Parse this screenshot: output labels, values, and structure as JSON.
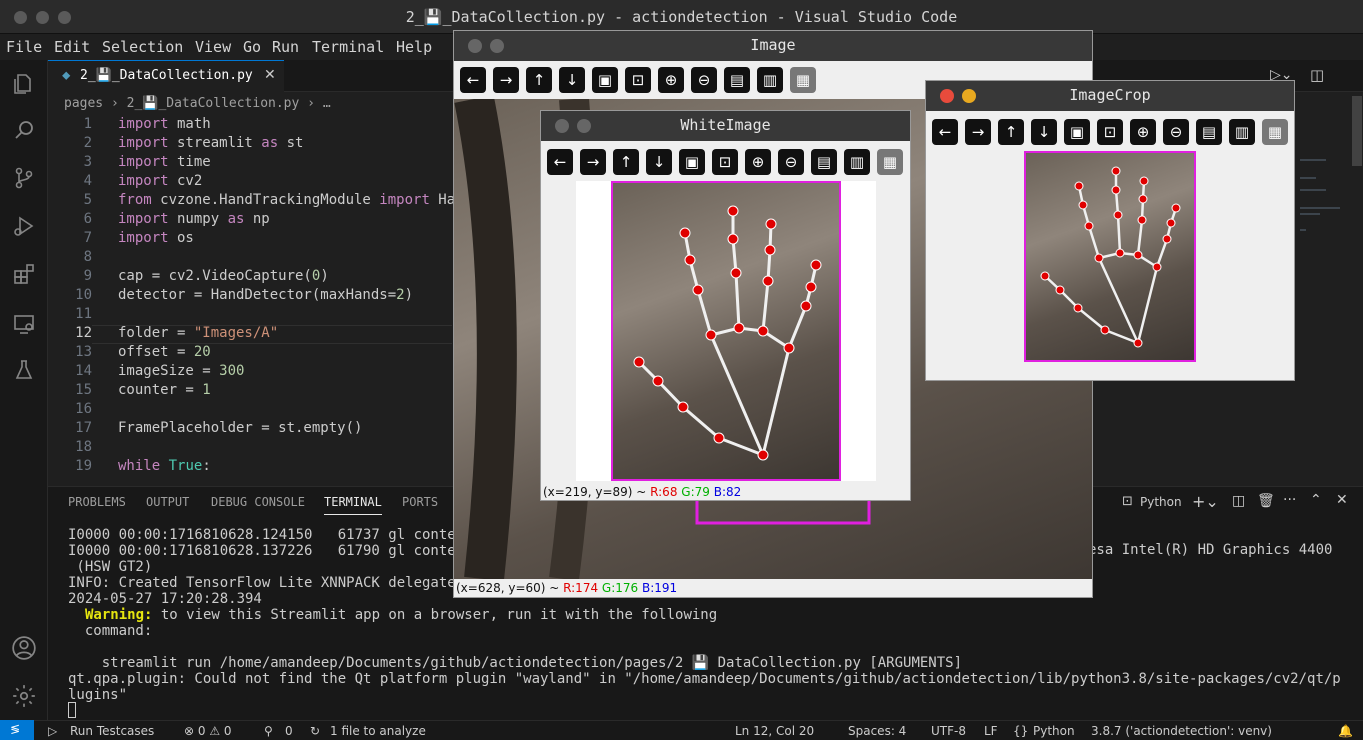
{
  "window": {
    "title": "2_💾_DataCollection.py - actiondetection - Visual Studio Code"
  },
  "menu": [
    "File",
    "Edit",
    "Selection",
    "View",
    "Go",
    "Run",
    "Terminal",
    "Help"
  ],
  "tab": {
    "label": "2_💾_DataCollection.py"
  },
  "breadcrumb": {
    "text": "pages › 2_💾_DataCollection.py › …"
  },
  "code": {
    "lines": [
      {
        "n": "1",
        "t": "import math"
      },
      {
        "n": "2",
        "t": "import streamlit as st"
      },
      {
        "n": "3",
        "t": "import time"
      },
      {
        "n": "4",
        "t": "import cv2"
      },
      {
        "n": "5",
        "t": "from cvzone.HandTrackingModule import Ha"
      },
      {
        "n": "6",
        "t": "import numpy as np"
      },
      {
        "n": "7",
        "t": "import os"
      },
      {
        "n": "8",
        "t": ""
      },
      {
        "n": "9",
        "t": "cap = cv2.VideoCapture(0)"
      },
      {
        "n": "10",
        "t": "detector = HandDetector(maxHands=2)"
      },
      {
        "n": "11",
        "t": ""
      },
      {
        "n": "12",
        "t": "folder = \"Images/A\""
      },
      {
        "n": "13",
        "t": "offset = 20"
      },
      {
        "n": "14",
        "t": "imageSize = 300"
      },
      {
        "n": "15",
        "t": "counter = 1"
      },
      {
        "n": "16",
        "t": ""
      },
      {
        "n": "17",
        "t": "FramePlaceholder = st.empty()"
      },
      {
        "n": "18",
        "t": ""
      },
      {
        "n": "19",
        "t": "while True:"
      }
    ]
  },
  "panel": {
    "tabs": [
      "PROBLEMS",
      "OUTPUT",
      "DEBUG CONSOLE",
      "TERMINAL",
      "PORTS"
    ],
    "shell": "Python",
    "terminal_lines": [
      "I0000 00:00:1716810628.124150   61737 gl conte",
      "I0000 00:00:1716810628.137226   61790 gl conte",
      " (HSW GT2)",
      "INFO: Created TensorFlow Lite XNNPACK delegate",
      "2024-05-27 17:20:28.394",
      "  to view this Streamlit app on a browser, run it with the following",
      "  command:",
      "",
      "    streamlit run /home/amandeep/Documents/github/actiondetection/pages/2 💾 DataCollection.py [ARGUMENTS]",
      "qt.qpa.plugin: Could not find the Qt platform plugin \"wayland\" in \"/home/amandeep/Documents/github/actiondetection/lib/python3.8/site-packages/cv2/qt/p",
      "lugins\""
    ],
    "warning_label": "Warning:",
    "right_text": "esa Intel(R) HD Graphics 4400"
  },
  "status": {
    "run": "Run Testcases",
    "problems": "⊗ 0 ⚠ 0",
    "ports": "0",
    "analyze": "1 file to analyze",
    "position": "Ln 12, Col 20",
    "spaces": "Spaces: 4",
    "encoding": "UTF-8",
    "eol": "LF",
    "language": "Python",
    "interpreter": "3.8.7 ('actiondetection': venv)"
  },
  "cv_image": {
    "title": "Image",
    "status_xy": "(x=628, y=60) ~ ",
    "r": "R:174",
    "g": "G:176",
    "b": "B:191"
  },
  "cv_white": {
    "title": "WhiteImage",
    "status_xy": "(x=219, y=89) ~ ",
    "r": "R:68",
    "g": "G:79",
    "b": "B:82"
  },
  "cv_crop": {
    "title": "ImageCrop"
  },
  "colors": {
    "accent": "#0078d4",
    "landmark": "#e00000",
    "box": "#e020e0"
  }
}
